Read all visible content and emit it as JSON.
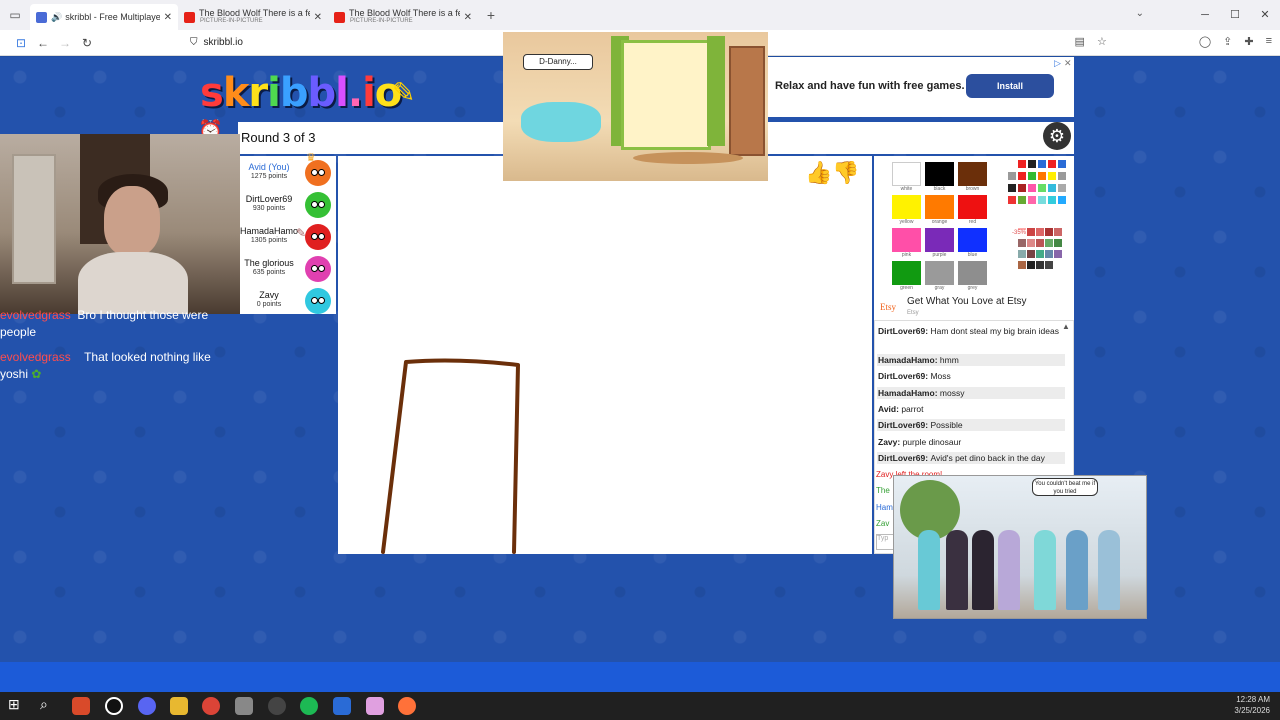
{
  "browser": {
    "tabs": [
      {
        "title": "skribbl - Free Multiplayer D",
        "subtitle": "",
        "active": true,
        "favicon_color": "#4a6bd6"
      },
      {
        "title": "The Blood Wolf There is a few sc",
        "subtitle": "PICTURE-IN-PICTURE",
        "active": false,
        "favicon_color": "#e62117"
      },
      {
        "title": "The Blood Wolf There is a few sc",
        "subtitle": "PICTURE-IN-PICTURE",
        "active": false,
        "favicon_color": "#e62117"
      }
    ],
    "url": "skribbl.io"
  },
  "game": {
    "logo_letters": [
      {
        "ch": "s",
        "color": "#ff3b3b"
      },
      {
        "ch": "k",
        "color": "#ff8c1a"
      },
      {
        "ch": "r",
        "color": "#ffe11a"
      },
      {
        "ch": "i",
        "color": "#4fd94f"
      },
      {
        "ch": "b",
        "color": "#3aa0ff"
      },
      {
        "ch": "b",
        "color": "#6a5cff"
      },
      {
        "ch": "l",
        "color": "#d94fff"
      },
      {
        "ch": ".",
        "color": "#ff66b3"
      },
      {
        "ch": "i",
        "color": "#ff3b3b"
      },
      {
        "ch": "o",
        "color": "#ffe11a"
      }
    ],
    "round_text": "Round 3 of 3",
    "players": [
      {
        "name": "Avid (You)",
        "points": "1275 points",
        "avatar_color": "#f07020",
        "me": true,
        "crown": true,
        "drawing": false
      },
      {
        "name": "DirtLover69",
        "points": "930 points",
        "avatar_color": "#35c035",
        "me": false,
        "crown": false,
        "drawing": false
      },
      {
        "name": "HamadaHamo",
        "points": "1305 points",
        "avatar_color": "#e02020",
        "me": false,
        "crown": false,
        "drawing": true
      },
      {
        "name": "The glorious",
        "points": "635 points",
        "avatar_color": "#e040b0",
        "me": false,
        "crown": false,
        "drawing": false
      },
      {
        "name": "Zavy",
        "points": "0 points",
        "avatar_color": "#30c8e0",
        "me": false,
        "crown": false,
        "drawing": false
      }
    ]
  },
  "ad_top": {
    "bubble": "D-Danny...",
    "text": "Relax and have fun with free games.",
    "button": "Install"
  },
  "palette": {
    "colors": [
      {
        "name": "white",
        "hex": "#ffffff"
      },
      {
        "name": "black",
        "hex": "#000000"
      },
      {
        "name": "brown",
        "hex": "#6b2f0a"
      },
      {
        "name": "yellow",
        "hex": "#fff200"
      },
      {
        "name": "orange",
        "hex": "#ff7a00"
      },
      {
        "name": "red",
        "hex": "#ee1111"
      },
      {
        "name": "pink",
        "hex": "#ff4fa8"
      },
      {
        "name": "purple",
        "hex": "#7a2ab8"
      },
      {
        "name": "blue",
        "hex": "#1030ff"
      },
      {
        "name": "green",
        "hex": "#119a11"
      },
      {
        "name": "gray",
        "hex": "#9a9a9a"
      },
      {
        "name": "grey",
        "hex": "#8e8e8e"
      }
    ],
    "percent_label": "-35%"
  },
  "etsy": {
    "logo": "Etsy",
    "text": "Get What You Love at Etsy",
    "sub": "Etsy"
  },
  "chat": [
    {
      "user": "DirtLover69",
      "text": "Ham dont steal my big brain ideas"
    },
    {
      "user": "HamadaHamo",
      "text": "hmm"
    },
    {
      "user": "DirtLover69",
      "text": "Moss"
    },
    {
      "user": "HamadaHamo",
      "text": "mossy"
    },
    {
      "user": "Avid",
      "text": "parrot"
    },
    {
      "user": "DirtLover69",
      "text": "Possible"
    },
    {
      "user": "Zavy",
      "text": "purple dinosaur"
    },
    {
      "user": "DirtLover69",
      "text": "Avid's pet dino back in the day"
    }
  ],
  "chat_partial": {
    "left_room": "Zavy left the room!",
    "fragments": [
      "The",
      "Ham",
      "Zav"
    ],
    "input_placeholder": "Typ"
  },
  "gacha_ad": {
    "bubble": "You couldn't beat me if you tried"
  },
  "stream_chat": [
    {
      "user": "evolvedgrass",
      "text": "Bro I thought those were",
      "cont": "people"
    },
    {
      "user": "evolvedgrass",
      "text": "That looked nothing like",
      "cont": "yoshi"
    }
  ],
  "taskbar": {
    "time": "12:28 AM",
    "date": "3/25/2026"
  },
  "colors": {
    "page_blue": "#2352ac",
    "stroke_brown": "#6b2f0a"
  }
}
